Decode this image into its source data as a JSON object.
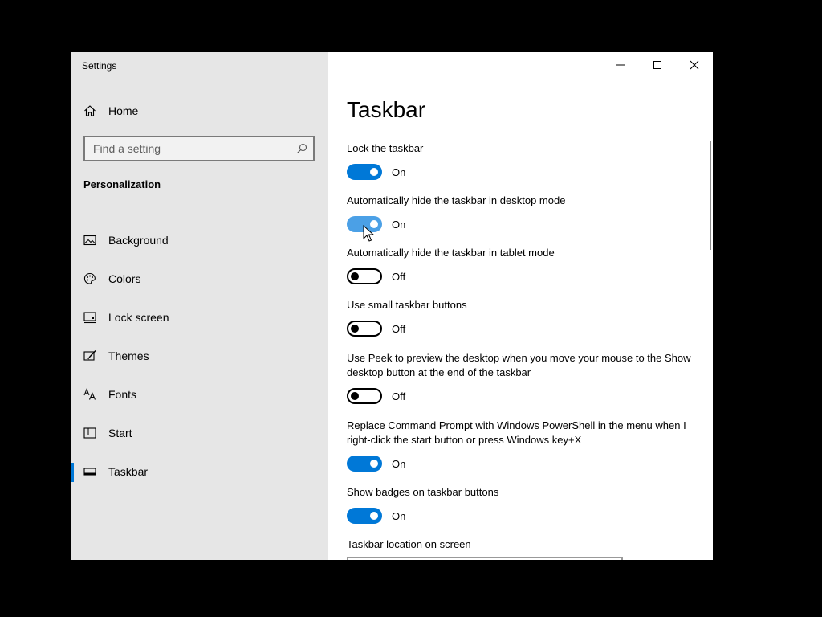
{
  "window": {
    "title": "Settings"
  },
  "sidebar": {
    "home_label": "Home",
    "search_placeholder": "Find a setting",
    "section_heading": "Personalization",
    "items": [
      {
        "label": "Background",
        "icon": "picture-icon"
      },
      {
        "label": "Colors",
        "icon": "palette-icon"
      },
      {
        "label": "Lock screen",
        "icon": "lock-screen-icon"
      },
      {
        "label": "Themes",
        "icon": "paintbrush-icon"
      },
      {
        "label": "Fonts",
        "icon": "font-icon"
      },
      {
        "label": "Start",
        "icon": "start-menu-icon"
      },
      {
        "label": "Taskbar",
        "icon": "taskbar-icon",
        "active": true
      }
    ]
  },
  "main": {
    "title": "Taskbar",
    "settings": [
      {
        "label": "Lock the taskbar",
        "state": "On"
      },
      {
        "label": "Automatically hide the taskbar in desktop mode",
        "state": "On"
      },
      {
        "label": "Automatically hide the taskbar in tablet mode",
        "state": "Off"
      },
      {
        "label": "Use small taskbar buttons",
        "state": "Off"
      },
      {
        "label": "Use Peek to preview the desktop when you move your mouse to the Show desktop button at the end of the taskbar",
        "state": "Off"
      },
      {
        "label": "Replace Command Prompt with Windows PowerShell in the menu when I right-click the start button or press Windows key+X",
        "state": "On"
      },
      {
        "label": "Show badges on taskbar buttons",
        "state": "On"
      }
    ],
    "location_label": "Taskbar location on screen"
  },
  "colors": {
    "accent": "#0078d7",
    "sidebar_bg": "#e6e6e6",
    "desktop_bg": "#000000"
  }
}
